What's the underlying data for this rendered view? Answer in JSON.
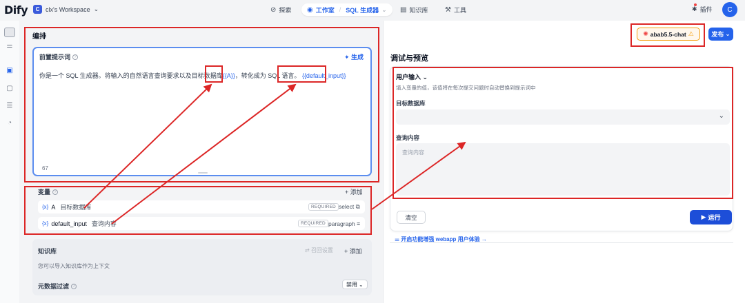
{
  "topbar": {
    "logo": "Dify",
    "workspace_badge": "C",
    "workspace_name": "clx's Workspace",
    "nav_explore": "探索",
    "nav_studio": "工作室",
    "nav_app": "SQL 生成器",
    "nav_knowledge": "知识库",
    "nav_tools": "工具",
    "plugins": "插件",
    "avatar": "C"
  },
  "orchestrate": {
    "title": "编排",
    "prompt_label": "前置提示词",
    "generate": "生成",
    "prompt_text_1": "你是一个 SQL 生成器。将输入的自然语言查询要求以及目标数据库",
    "prompt_var_a": "{{A}}",
    "prompt_text_2": "，转化成为 SQL 语言。",
    "prompt_var_default": "{{default_input}}",
    "char_count": "67"
  },
  "variables": {
    "title": "变量",
    "add": "+ 添加",
    "rows": [
      {
        "key": "A",
        "label": "目标数据库",
        "required": "REQUIRED",
        "type": "select"
      },
      {
        "key": "default_input",
        "label": "查询内容",
        "required": "REQUIRED",
        "type": "paragraph"
      }
    ]
  },
  "knowledge": {
    "title": "知识库",
    "settings": "召回设置",
    "add": "+ 添加",
    "desc": "您可以导入知识库作为上下文",
    "meta_filter": "元数据过滤",
    "meta_state": "禁用"
  },
  "debug": {
    "model_name": "abab5.5-chat",
    "publish": "发布",
    "title": "调试与预览",
    "user_input": "用户输入",
    "user_input_desc": "填入变量的值，该值将在每次提交问题时自动替换到提示词中",
    "field1_label": "目标数据库",
    "field2_label": "查询内容",
    "field2_placeholder": "查询内容",
    "clear": "清空",
    "run": "运行",
    "webapp_link": "开启功能增强 webapp 用户体验 →"
  },
  "colors": {
    "accent": "#2563eb",
    "annotation": "#dc2626",
    "warning": "#f59e0b"
  }
}
